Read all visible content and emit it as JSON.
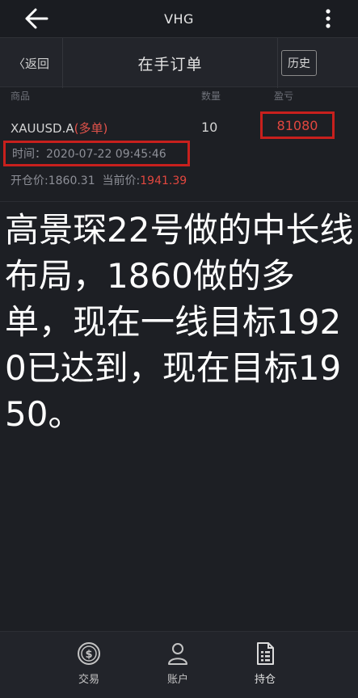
{
  "header": {
    "title": "VHG"
  },
  "subbar": {
    "back_label": "〈返回",
    "title": "在手订单",
    "history_label": "历史"
  },
  "columns": {
    "product": "商品",
    "quantity": "数量",
    "pnl": "盈亏"
  },
  "order": {
    "symbol": "XAUUSD.A",
    "side": "(多单)",
    "quantity": "10",
    "pnl": "81080",
    "time": "时间：2020-07-22 09:45:46",
    "open_label": "开仓价:",
    "open_price": "1860.31",
    "current_label": "当前价:",
    "current_price": "1941.39"
  },
  "overlay_text": "高景琛22号做的中长线布局，1860做的多单，现在一线目标1920已达到，现在目标1950。",
  "nav": {
    "items": [
      {
        "label": "交易",
        "icon": "dollar-coin-icon"
      },
      {
        "label": "账户",
        "icon": "person-icon"
      },
      {
        "label": "持仓",
        "icon": "document-icon"
      }
    ]
  },
  "colors": {
    "accent_red": "#e2473f",
    "highlight_box": "#c8201d",
    "background": "#1d1f24"
  }
}
